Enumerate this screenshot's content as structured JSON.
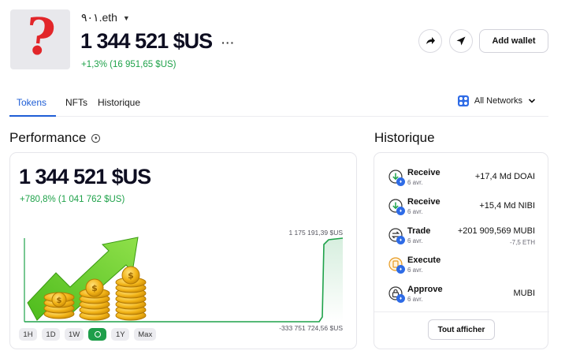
{
  "wallet": {
    "name": "٩٠١.eth",
    "balance": "1 344 521 $US",
    "change": "+1,3% (16 951,65 $US)",
    "avatar_glyph": "?"
  },
  "header_actions": {
    "share_icon": "share-arrow-icon",
    "send_icon": "send-icon",
    "add_wallet_label": "Add wallet"
  },
  "tabs": [
    {
      "label": "Tokens",
      "active": true
    },
    {
      "label": "NFTs",
      "active": false
    },
    {
      "label": "Historique",
      "active": false
    }
  ],
  "networks": {
    "label": "All Networks"
  },
  "performance": {
    "title": "Performance",
    "value": "1 344 521 $US",
    "change": "+780,8% (1 041 762 $US)",
    "max_label": "1 175 191,39 $US",
    "min_label": "-333 751 724,56 $US",
    "ranges": [
      "1H",
      "1D",
      "1W",
      "",
      "1Y",
      "Max"
    ],
    "active_range_index": 3
  },
  "chart_data": {
    "type": "line",
    "x": [
      0,
      1,
      2,
      3,
      4,
      5,
      6,
      7,
      8,
      9,
      10,
      11,
      12,
      13,
      14,
      15,
      16,
      17,
      18,
      19,
      20
    ],
    "y": [
      -333751724.56,
      -333751724.56,
      -333751724.56,
      -333751724.56,
      -333751724.56,
      -333751724.56,
      -333751724.56,
      -333751724.56,
      -333751724.56,
      -333751724.56,
      -333751724.56,
      -333751724.56,
      -333751724.56,
      -333751724.56,
      -333751724.56,
      -333751724.56,
      -333751724.56,
      -300000000,
      1100000000,
      1150000000,
      1175191.39
    ],
    "ylim": [
      -333751724.56,
      1175191.39
    ],
    "grid": false,
    "color": "#1fa24a"
  },
  "history": {
    "title": "Historique",
    "rows": [
      {
        "type": "Receive",
        "date": "6 avr.",
        "amount": "+17,4 Md DOAI",
        "sub": "",
        "icon": "receive-icon"
      },
      {
        "type": "Receive",
        "date": "6 avr.",
        "amount": "+15,4 Md NIBI",
        "sub": "",
        "icon": "receive-icon"
      },
      {
        "type": "Trade",
        "date": "6 avr.",
        "amount": "+201 909,569 MUBI",
        "sub": "-7,5 ETH",
        "icon": "trade-icon"
      },
      {
        "type": "Execute",
        "date": "6 avr.",
        "amount": "",
        "sub": "",
        "icon": "execute-icon"
      },
      {
        "type": "Approve",
        "date": "6 avr.",
        "amount": "MUBI",
        "sub": "",
        "icon": "approve-icon"
      }
    ],
    "show_all_label": "Tout afficher"
  }
}
